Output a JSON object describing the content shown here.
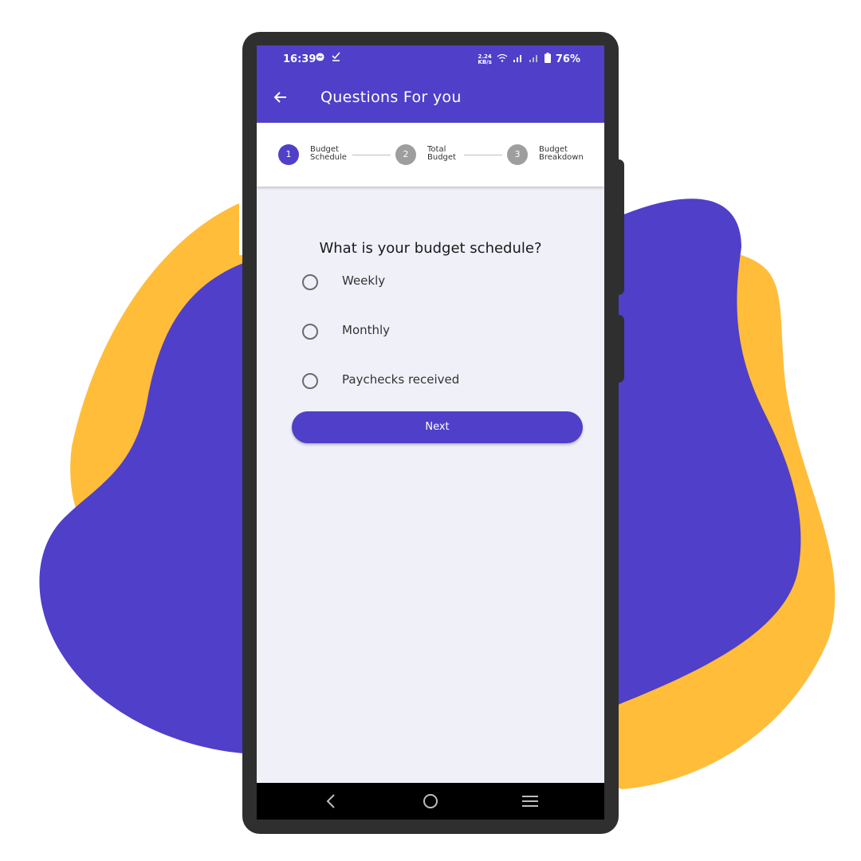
{
  "status_bar": {
    "time": "16:39",
    "left_icons": [
      "messenger-icon",
      "download-done-icon"
    ],
    "network_speed_value": "2.24",
    "network_speed_unit": "KB/s",
    "battery": "76%"
  },
  "app_bar": {
    "title": "Questions For you",
    "back_icon": "arrow-left-icon"
  },
  "stepper": {
    "steps": [
      {
        "number": "1",
        "line1": "Budget",
        "line2": "Schedule",
        "active": true
      },
      {
        "number": "2",
        "line1": "Total",
        "line2": "Budget",
        "active": false
      },
      {
        "number": "3",
        "line1": "Budget",
        "line2": "Breakdown",
        "active": false
      }
    ]
  },
  "question": "What is your budget schedule?",
  "options": [
    "Weekly",
    "Monthly",
    "Paychecks received"
  ],
  "next_label": "Next",
  "colors": {
    "primary": "#4f3fc9",
    "accent_blob": "#ffbd3a",
    "background": "#f0f0f9",
    "inactive_step": "#9e9e9e"
  }
}
